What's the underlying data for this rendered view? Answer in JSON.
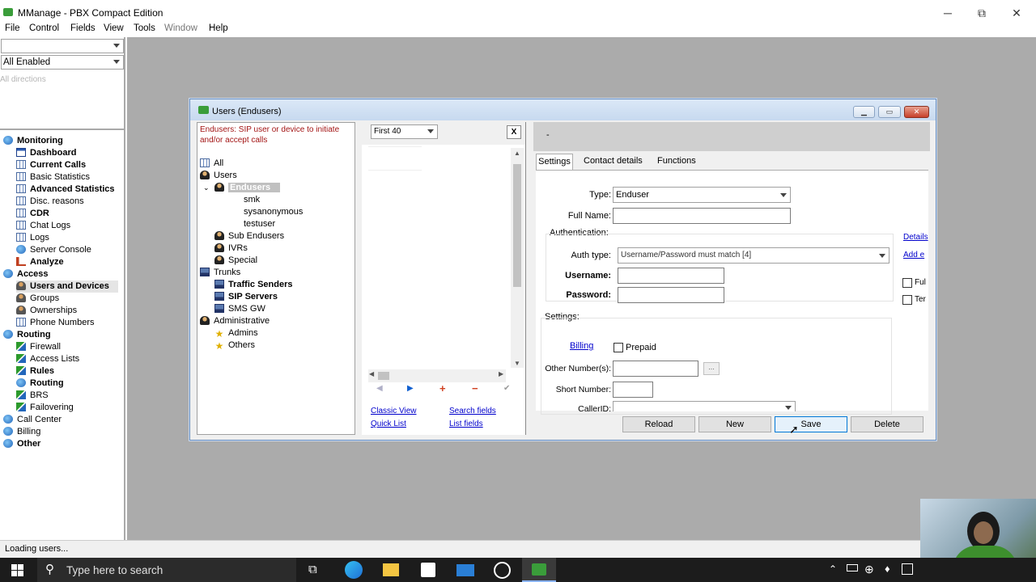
{
  "window": {
    "title": "MManage - PBX Compact Edition",
    "minimize": "─",
    "restore": "⧉",
    "close": "✕"
  },
  "menu": [
    "File",
    "Control",
    "Fields",
    "View",
    "Tools",
    "Window",
    "Help"
  ],
  "left": {
    "combo1": "",
    "combo2": "All Enabled",
    "directions": "All directions",
    "tree": [
      {
        "label": "Monitoring",
        "level": 0,
        "bold": true,
        "icon": "globe"
      },
      {
        "label": "Dashboard",
        "level": 1,
        "bold": true,
        "icon": "window"
      },
      {
        "label": "Current Calls",
        "level": 1,
        "bold": true,
        "icon": "grid"
      },
      {
        "label": "Basic Statistics",
        "level": 1,
        "bold": false,
        "icon": "grid"
      },
      {
        "label": "Advanced Statistics",
        "level": 1,
        "bold": true,
        "icon": "grid"
      },
      {
        "label": "Disc. reasons",
        "level": 1,
        "bold": false,
        "icon": "grid"
      },
      {
        "label": "CDR",
        "level": 1,
        "bold": true,
        "icon": "grid"
      },
      {
        "label": "Chat Logs",
        "level": 1,
        "bold": false,
        "icon": "grid"
      },
      {
        "label": "Logs",
        "level": 1,
        "bold": false,
        "icon": "grid"
      },
      {
        "label": "Server Console",
        "level": 1,
        "bold": false,
        "icon": "globe"
      },
      {
        "label": "Analyze",
        "level": 1,
        "bold": true,
        "icon": "chart"
      },
      {
        "label": "Access",
        "level": 0,
        "bold": true,
        "icon": "globe"
      },
      {
        "label": "Users and Devices",
        "level": 1,
        "bold": true,
        "icon": "users",
        "selected": true
      },
      {
        "label": "Groups",
        "level": 1,
        "bold": false,
        "icon": "users"
      },
      {
        "label": "Ownerships",
        "level": 1,
        "bold": false,
        "icon": "users"
      },
      {
        "label": "Phone Numbers",
        "level": 1,
        "bold": false,
        "icon": "grid"
      },
      {
        "label": "Routing",
        "level": 0,
        "bold": true,
        "icon": "globe"
      },
      {
        "label": "Firewall",
        "level": 1,
        "bold": false,
        "icon": "route"
      },
      {
        "label": "Access Lists",
        "level": 1,
        "bold": false,
        "icon": "route"
      },
      {
        "label": "Rules",
        "level": 1,
        "bold": true,
        "icon": "route"
      },
      {
        "label": "Routing",
        "level": 1,
        "bold": true,
        "icon": "globe"
      },
      {
        "label": "BRS",
        "level": 1,
        "bold": false,
        "icon": "route"
      },
      {
        "label": "Failovering",
        "level": 1,
        "bold": false,
        "icon": "route"
      },
      {
        "label": "Call Center",
        "level": 0,
        "bold": false,
        "icon": "globe"
      },
      {
        "label": "Billing",
        "level": 0,
        "bold": false,
        "icon": "globe"
      },
      {
        "label": "Other",
        "level": 0,
        "bold": true,
        "icon": "globe"
      }
    ]
  },
  "status": "Loading users...",
  "dialog": {
    "title": "Users (Endusers)",
    "hint": "Endusers: SIP user or device to initiate and/or accept calls",
    "tree": [
      {
        "label": "All",
        "indent": 0,
        "icon": "grid"
      },
      {
        "label": "Users",
        "indent": 0,
        "icon": "user"
      },
      {
        "label": "Endusers",
        "indent": 1,
        "icon": "user",
        "selected": true,
        "expand": "v"
      },
      {
        "label": "smk",
        "indent": 3,
        "icon": ""
      },
      {
        "label": "sysanonymous",
        "indent": 3,
        "icon": ""
      },
      {
        "label": "testuser",
        "indent": 3,
        "icon": ""
      },
      {
        "label": "Sub Endusers",
        "indent": 1,
        "icon": "user"
      },
      {
        "label": "IVRs",
        "indent": 1,
        "icon": "user"
      },
      {
        "label": "Special",
        "indent": 1,
        "icon": "user"
      },
      {
        "label": "Trunks",
        "indent": 0,
        "icon": "pc"
      },
      {
        "label": "Traffic Senders",
        "indent": 1,
        "icon": "pc",
        "bold": true
      },
      {
        "label": "SIP Servers",
        "indent": 1,
        "icon": "pc",
        "bold": true
      },
      {
        "label": "SMS GW",
        "indent": 1,
        "icon": "pc"
      },
      {
        "label": "Administrative",
        "indent": 0,
        "icon": "user"
      },
      {
        "label": "Admins",
        "indent": 1,
        "icon": "star"
      },
      {
        "label": "Others",
        "indent": 1,
        "icon": "star"
      }
    ],
    "list": {
      "filter": "First 40",
      "close": "X",
      "links": [
        "Classic View",
        "Search fields",
        "Quick List",
        "List fields"
      ]
    },
    "detail": {
      "header": "-",
      "tabs": [
        "Settings",
        "Contact details",
        "Functions"
      ],
      "type_label": "Type:",
      "type_value": "Enduser",
      "fullname_label": "Full Name:",
      "fullname_value": "",
      "auth_group": "Authentication:",
      "authtype_label": "Auth type:",
      "authtype_value": "Username/Password must match [4]",
      "username_label": "Username:",
      "password_label": "Password:",
      "settings_group": "Settings:",
      "billing_link": "Billing",
      "prepaid": "Prepaid",
      "other_numbers_label": "Other Number(s):",
      "ellipsis": "...",
      "short_number_label": "Short Number:",
      "callerid_label": "CallerID:",
      "side_links": [
        "Details",
        "Add e"
      ],
      "side_checks": [
        "Ful",
        "Ter"
      ]
    },
    "buttons": [
      "Reload",
      "New",
      "Save",
      "Delete"
    ]
  },
  "taskbar": {
    "search": "Type here to search"
  }
}
